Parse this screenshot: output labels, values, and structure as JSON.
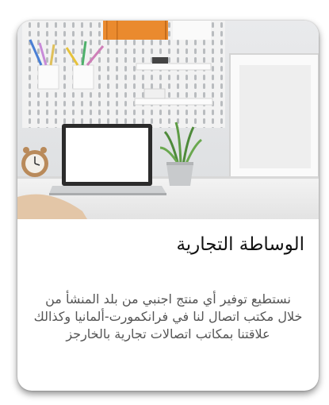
{
  "card": {
    "title": "الوساطة التجارية",
    "description": "نستطيع توفير أي منتج اجنبي من بلد المنشأ من خلال مكتب اتصال لنا في فرانكمورت-ألمانيا وكذالك علاقتنا بمكاتب اتصالات تجارية بالخارجز"
  },
  "colors": {
    "title_text": "#111111",
    "description_text": "#555555",
    "card_background": "#ffffff"
  }
}
